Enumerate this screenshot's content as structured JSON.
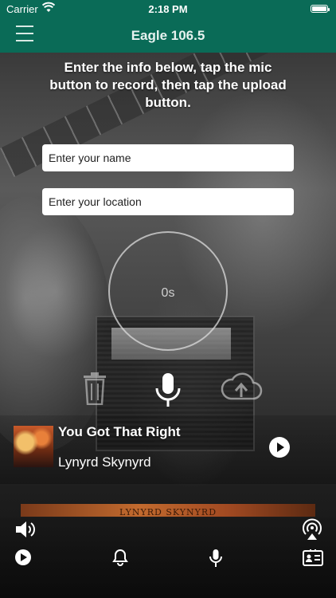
{
  "status_bar": {
    "carrier": "Carrier",
    "time": "2:18 PM"
  },
  "header": {
    "title": "Eagle 106.5"
  },
  "recorder": {
    "instructions": "Enter the info below, tap the mic button to record, then tap the upload button.",
    "name_placeholder": "Enter your name",
    "location_placeholder": "Enter your location",
    "timer": "0s"
  },
  "now_playing": {
    "title": "You Got That Right",
    "artist": "Lynyrd Skynyrd",
    "album_banner_text": "LYNYRD SKYNYRD"
  },
  "icons": {
    "menu": "hamburger-menu-icon",
    "trash": "trash-icon",
    "record": "microphone-icon",
    "upload": "cloud-upload-icon",
    "volume": "speaker-icon",
    "airplay": "airplay-icon",
    "play": "play-circle-icon",
    "notifications": "bell-icon",
    "mic_tab": "microphone-icon",
    "contact": "contact-card-icon"
  },
  "colors": {
    "header_bg": "#0a6b57",
    "accent_text": "#ffffff"
  }
}
